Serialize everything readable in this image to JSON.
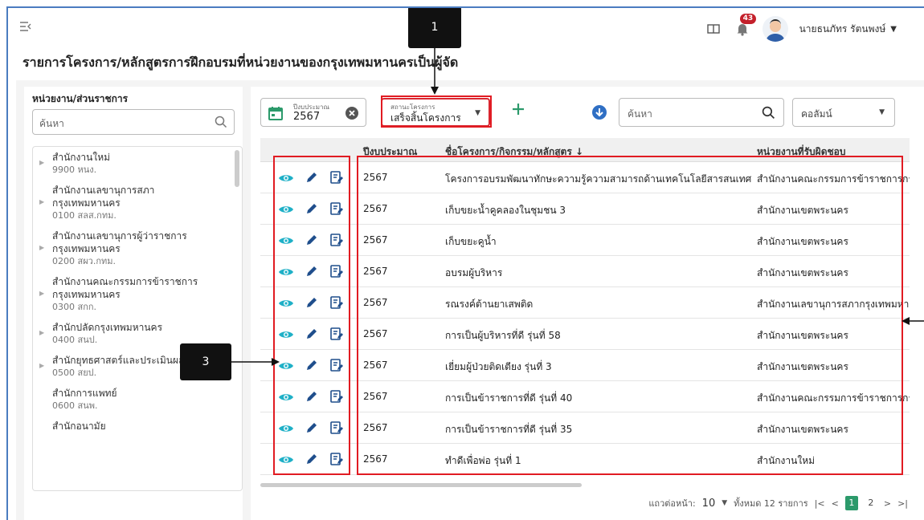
{
  "header": {
    "notification_count": "43",
    "user_name": "นายธนภัทร รัตนพงษ์"
  },
  "page_title": "รายการโครงการ/หลักสูตรการฝึกอบรมที่หน่วยงานของกรุงเทพมหานครเป็นผู้จัด",
  "sidebar": {
    "title": "หน่วยงาน/ส่วนราชการ",
    "search_placeholder": "ค้นหา",
    "items": [
      {
        "name": "สำนักงานใหม่",
        "code": "9900 หนง."
      },
      {
        "name": "สำนักงานเลขานุการสภา กรุงเทพมหานคร",
        "code": "0100 สลส.กทม."
      },
      {
        "name": "สำนักงานเลขานุการผู้ว่าราชการ กรุงเทพมหานคร",
        "code": "0200 สผว.กทม."
      },
      {
        "name": "สำนักงานคณะกรรมการข้าราชการ กรุงเทพมหานคร",
        "code": "0300 สกก."
      },
      {
        "name": "สำนักปลัดกรุงเทพมหานคร",
        "code": "0400 สนป."
      },
      {
        "name": "สำนักยุทธศาสตร์และประเมินผล",
        "code": "0500 สยป."
      },
      {
        "name": "สำนักการแพทย์",
        "code": "0600 สนพ."
      },
      {
        "name": "สำนักอนามัย",
        "code": ""
      }
    ]
  },
  "toolbar": {
    "year_label": "ปีงบประมาณ",
    "year_value": "2567",
    "status_label": "สถานะโครงการ",
    "status_value": "เสร็จสิ้นโครงการ",
    "search_placeholder": "ค้นหา",
    "column_label": "คอลัมน์"
  },
  "table": {
    "headers": {
      "year": "ปีงบประมาณ",
      "name": "ชื่อโครงการ/กิจกรรม/หลักสูตร ↓",
      "dept": "หน่วยงานที่รับผิดชอบ"
    },
    "rows": [
      {
        "year": "2567",
        "name": "โครงการอบรมพัฒนาทักษะความรู้ความสามารถด้านเทคโนโลยีสารสนเทศ",
        "dept": "สำนักงานคณะกรรมการข้าราชการกรุงเทพมหานคร"
      },
      {
        "year": "2567",
        "name": "เก็บขยะน้ำคูคลองในชุมชน 3",
        "dept": "สำนักงานเขตพระนคร"
      },
      {
        "year": "2567",
        "name": "เก็บขยะคูน้ำ",
        "dept": "สำนักงานเขตพระนคร"
      },
      {
        "year": "2567",
        "name": "อบรมผู้บริหาร",
        "dept": "สำนักงานเขตพระนคร"
      },
      {
        "year": "2567",
        "name": "รณรงค์ต้านยาเสพติด",
        "dept": "สำนักงานเลขานุการสภากรุงเทพมหานคร"
      },
      {
        "year": "2567",
        "name": "การเป็นผู้บริหารที่ดี รุ่นที่ 58",
        "dept": "สำนักงานเขตพระนคร"
      },
      {
        "year": "2567",
        "name": "เยี่ยมผู้ป่วยติดเตียง รุ่นที่ 3",
        "dept": "สำนักงานเขตพระนคร"
      },
      {
        "year": "2567",
        "name": "การเป็นข้าราชการที่ดี รุ่นที่ 40",
        "dept": "สำนักงานคณะกรรมการข้าราชการกรุงเทพมหานคร"
      },
      {
        "year": "2567",
        "name": "การเป็นข้าราชการที่ดี รุ่นที่ 35",
        "dept": "สำนักงานเขตพระนคร"
      },
      {
        "year": "2567",
        "name": "ทำดีเพื่อพ่อ รุ่นที่ 1",
        "dept": "สำนักงานใหม่"
      }
    ]
  },
  "pagination": {
    "rows_per_page_label": "แถวต่อหน้า:",
    "rows_per_page": "10",
    "total_label": "ทั้งหมด 12 รายการ",
    "pages": [
      "1",
      "2"
    ],
    "current_page": "1"
  },
  "annotations": {
    "callout_1": "1",
    "callout_3": "3"
  },
  "colors": {
    "accent": "#2c9a6b",
    "view_icon": "#1fb0c7",
    "edit_icon": "#1f4e8c",
    "annotation": "#e11b22",
    "badge": "#c4202b"
  }
}
